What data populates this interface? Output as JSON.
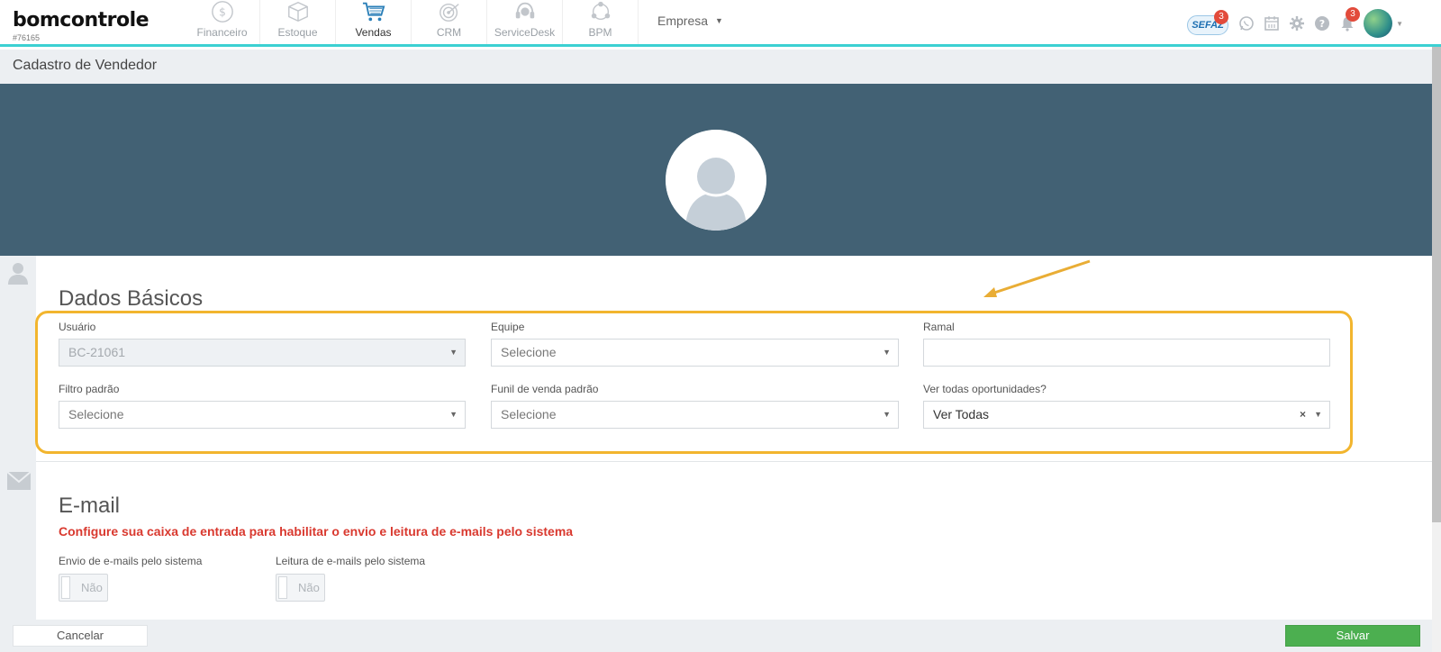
{
  "app": {
    "logo": "bomcontrole",
    "account_id": "#76165"
  },
  "nav": {
    "modules": [
      {
        "label": "Financeiro",
        "icon": "dollar-coin-icon"
      },
      {
        "label": "Estoque",
        "icon": "box-icon"
      },
      {
        "label": "Vendas",
        "icon": "shopping-cart-icon"
      },
      {
        "label": "CRM",
        "icon": "target-icon"
      },
      {
        "label": "ServiceDesk",
        "icon": "headset-icon"
      },
      {
        "label": "BPM",
        "icon": "process-cycle-icon"
      }
    ],
    "company_dropdown": "Empresa",
    "sefaz_label": "SEFAZ",
    "sefaz_badge": "3",
    "notifications_badge": "3"
  },
  "page": {
    "title": "Cadastro de Vendedor"
  },
  "dados_basicos": {
    "title": "Dados Básicos",
    "usuario": {
      "label": "Usuário",
      "value": "BC-21061"
    },
    "equipe": {
      "label": "Equipe",
      "value": "Selecione"
    },
    "ramal": {
      "label": "Ramal",
      "value": ""
    },
    "filtro_padrao": {
      "label": "Filtro padrão",
      "value": "Selecione"
    },
    "funil": {
      "label": "Funil de venda padrão",
      "value": "Selecione"
    },
    "ver_todas": {
      "label": "Ver todas oportunidades?",
      "value": "Ver Todas",
      "clear": "×"
    }
  },
  "email": {
    "title": "E-mail",
    "warning": "Configure sua caixa de entrada para habilitar o envio e leitura de e-mails pelo sistema",
    "envio": {
      "label": "Envio de e-mails pelo sistema",
      "value": "Não"
    },
    "leitura": {
      "label": "Leitura de e-mails pelo sistema",
      "value": "Não"
    }
  },
  "footer": {
    "cancel": "Cancelar",
    "save": "Salvar"
  },
  "colors": {
    "accent": "#3cd0d2",
    "banner": "#426174",
    "highlight": "#f2b52e",
    "warning": "#d9392f",
    "save": "#4caf50"
  }
}
